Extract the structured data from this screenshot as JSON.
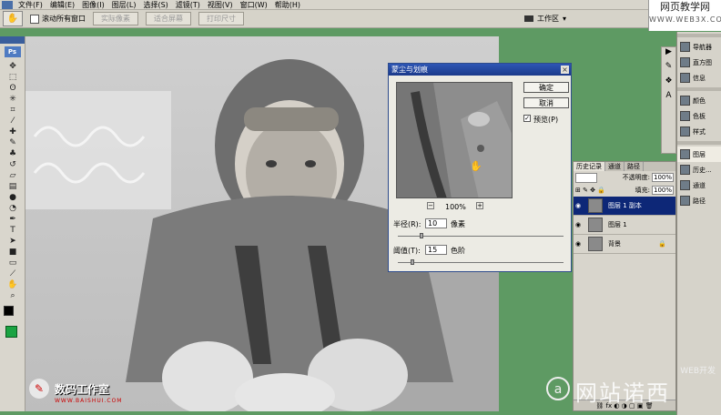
{
  "menu": {
    "items": [
      "文件(F)",
      "编辑(E)",
      "图像(I)",
      "图层(L)",
      "选择(S)",
      "滤镜(T)",
      "视图(V)",
      "窗口(W)",
      "帮助(H)"
    ]
  },
  "site_banner": {
    "title": "网页教学网",
    "url": "WWW.WEB3X.COM"
  },
  "options": {
    "scroll_all": "滚动所有窗口",
    "actual_pixels": "实际像素",
    "fit_screen": "适合屏幕",
    "print_size": "打印尺寸",
    "workspace": "工作区"
  },
  "toolbox": {
    "ps_label": "Ps"
  },
  "watermarks": {
    "studio": "数码工作室",
    "studio_url": "WWW.BAISHUI.COM",
    "dev": "WEB开发",
    "brand": "网站诺西"
  },
  "dialog": {
    "title": "蒙尘与划痕",
    "ok": "确定",
    "cancel": "取消",
    "preview": "预览(P)",
    "zoom": "100%",
    "radius_label": "半径(R):",
    "radius_value": "10",
    "radius_unit": "像素",
    "threshold_label": "阈值(T):",
    "threshold_value": "15",
    "threshold_unit": "色阶"
  },
  "layers_panel": {
    "tabs": [
      "历史记录",
      "通道",
      "路径"
    ],
    "opacity_label": "不透明度:",
    "opacity_value": "100%",
    "fill_label": "填充:",
    "fill_value": "100%",
    "layers": [
      {
        "name": "图层 1 副本",
        "selected": true
      },
      {
        "name": "图层 1",
        "selected": false
      },
      {
        "name": "背景",
        "selected": false
      }
    ]
  },
  "dock": {
    "group1": [
      "导航器",
      "直方图",
      "信息"
    ],
    "group2": [
      "颜色",
      "色板",
      "样式"
    ],
    "group3": [
      "图层",
      "历史...",
      "通道",
      "路径"
    ]
  },
  "colors": {
    "background": "#5e9a63",
    "dialog_title": "#1b3a8a",
    "selected_layer": "#0d2777"
  }
}
